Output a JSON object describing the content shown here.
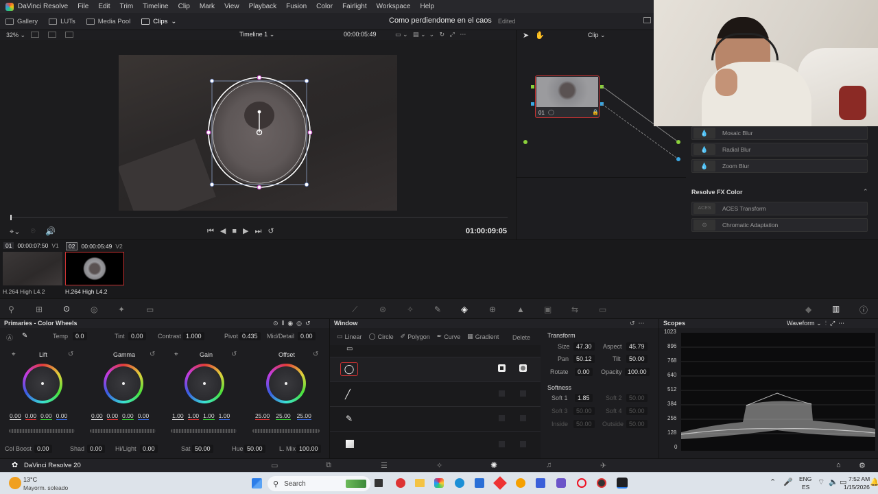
{
  "app": {
    "name": "DaVinci Resolve",
    "menu": [
      "File",
      "Edit",
      "Trim",
      "Timeline",
      "Clip",
      "Mark",
      "View",
      "Playback",
      "Fusion",
      "Color",
      "Fairlight",
      "Workspace",
      "Help"
    ],
    "project_title": "Como perdiendome en el caos",
    "project_state": "Edited",
    "version_label": "DaVinci Resolve 20"
  },
  "toolbar": {
    "gallery": "Gallery",
    "luts": "LUTs",
    "media_pool": "Media Pool",
    "clips": "Clips"
  },
  "viewer": {
    "zoom": "32%",
    "timeline_name": "Timeline 1",
    "timecode_top": "00:00:05:49",
    "mode": "Clip",
    "timecode_main": "01:00:09:05"
  },
  "nodes": {
    "node_label": "01"
  },
  "fx": {
    "items_top": [
      "Mosaic Blur",
      "Radial Blur",
      "Zoom Blur"
    ],
    "section_title": "Resolve FX Color",
    "items_color": [
      "ACES Transform",
      "Chromatic Adaptation"
    ],
    "aces_thumb": "ACES"
  },
  "clips": [
    {
      "num": "01",
      "tc": "00:00:07:50",
      "track": "V1",
      "codec": "H.264 High L4.2"
    },
    {
      "num": "02",
      "tc": "00:00:05:49",
      "track": "V2",
      "codec": "H.264 High L4.2"
    }
  ],
  "primaries": {
    "title": "Primaries - Color Wheels",
    "temp_label": "Temp",
    "temp": "0.0",
    "tint_label": "Tint",
    "tint": "0.00",
    "contrast_label": "Contrast",
    "contrast": "1.000",
    "pivot_label": "Pivot",
    "pivot": "0.435",
    "middetail_label": "Mid/Detail",
    "middetail": "0.00",
    "wheels": [
      {
        "name": "Lift",
        "vals": [
          "0.00",
          "0.00",
          "0.00",
          "0.00"
        ]
      },
      {
        "name": "Gamma",
        "vals": [
          "0.00",
          "0.00",
          "0.00",
          "0.00"
        ]
      },
      {
        "name": "Gain",
        "vals": [
          "1.00",
          "1.00",
          "1.00",
          "1.00"
        ]
      },
      {
        "name": "Offset",
        "vals": [
          "25.00",
          "25.00",
          "25.00"
        ]
      }
    ],
    "colboost_label": "Col Boost",
    "colboost": "0.00",
    "shad_label": "Shad",
    "shad": "0.00",
    "hilight_label": "Hi/Light",
    "hilight": "0.00",
    "sat_label": "Sat",
    "sat": "50.00",
    "hue_label": "Hue",
    "hue": "50.00",
    "lmix_label": "L. Mix",
    "lmix": "100.00"
  },
  "window": {
    "title": "Window",
    "tools": [
      "Linear",
      "Circle",
      "Polygon",
      "Curve",
      "Gradient"
    ],
    "delete": "Delete",
    "transform_title": "Transform",
    "size_label": "Size",
    "size": "47.30",
    "aspect_label": "Aspect",
    "aspect": "45.79",
    "pan_label": "Pan",
    "pan": "50.12",
    "tilt_label": "Tilt",
    "tilt": "50.00",
    "rotate_label": "Rotate",
    "rotate": "0.00",
    "opacity_label": "Opacity",
    "opacity": "100.00",
    "softness_title": "Softness",
    "soft1_label": "Soft 1",
    "soft1": "1.85",
    "soft2_label": "Soft 2",
    "soft2": "50.00",
    "soft3_label": "Soft 3",
    "soft3": "50.00",
    "soft4_label": "Soft 4",
    "soft4": "50.00",
    "inside_label": "Inside",
    "inside": "50.00",
    "outside_label": "Outside",
    "outside": "50.00"
  },
  "scopes": {
    "title": "Scopes",
    "mode": "Waveform",
    "scale": [
      "1023",
      "896",
      "768",
      "640",
      "512",
      "384",
      "256",
      "128",
      "0"
    ]
  },
  "taskbar": {
    "temp": "13°C",
    "weather": "Mayorm. soleado",
    "search": "Search",
    "lang1": "ENG",
    "lang2": "ES",
    "time": "7:52 AM",
    "date": "1/15/2026"
  }
}
